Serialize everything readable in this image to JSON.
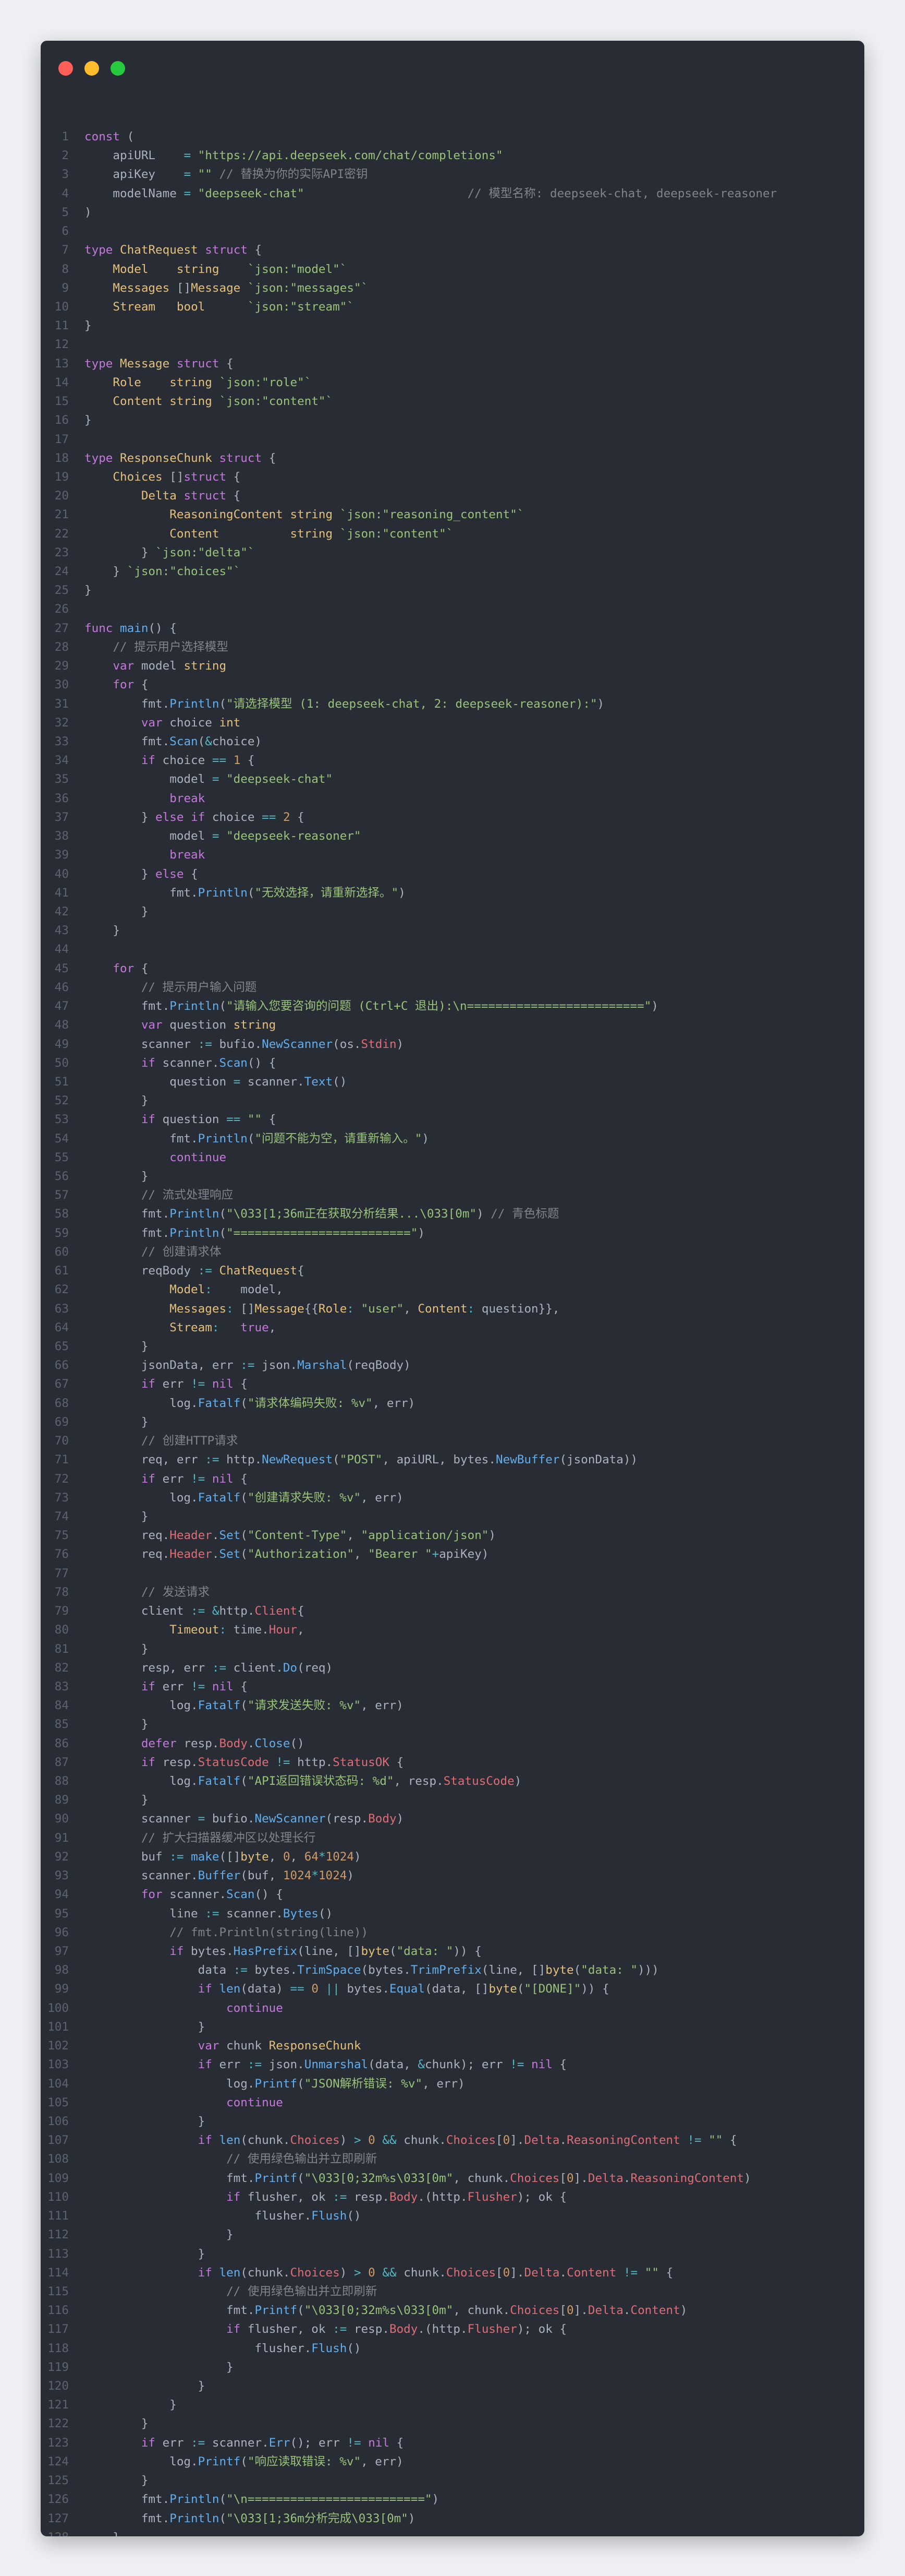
{
  "window": {
    "colors": {
      "background": "#282c34",
      "close": "#ff5f56",
      "minimize": "#ffbd2e",
      "maximize": "#27c93f"
    }
  },
  "code_lines": [
    "const (",
    "    apiURL    = \"https://api.deepseek.com/chat/completions\"",
    "    apiKey    = \"\" // 替换为你的实际API密钥",
    "    modelName = \"deepseek-chat\"                       // 模型名称: deepseek-chat, deepseek-reasoner",
    ")",
    "",
    "type ChatRequest struct {",
    "    Model    string    `json:\"model\"`",
    "    Messages []Message `json:\"messages\"`",
    "    Stream   bool      `json:\"stream\"`",
    "}",
    "",
    "type Message struct {",
    "    Role    string `json:\"role\"`",
    "    Content string `json:\"content\"`",
    "}",
    "",
    "type ResponseChunk struct {",
    "    Choices []struct {",
    "        Delta struct {",
    "            ReasoningContent string `json:\"reasoning_content\"`",
    "            Content          string `json:\"content\"`",
    "        } `json:\"delta\"`",
    "    } `json:\"choices\"`",
    "}",
    "",
    "func main() {",
    "    // 提示用户选择模型",
    "    var model string",
    "    for {",
    "        fmt.Println(\"请选择模型 (1: deepseek-chat, 2: deepseek-reasoner):\")",
    "        var choice int",
    "        fmt.Scan(&choice)",
    "        if choice == 1 {",
    "            model = \"deepseek-chat\"",
    "            break",
    "        } else if choice == 2 {",
    "            model = \"deepseek-reasoner\"",
    "            break",
    "        } else {",
    "            fmt.Println(\"无效选择，请重新选择。\")",
    "        }",
    "    }",
    "",
    "    for {",
    "        // 提示用户输入问题",
    "        fmt.Println(\"请输入您要咨询的问题 (Ctrl+C 退出):\\n=========================\")",
    "        var question string",
    "        scanner := bufio.NewScanner(os.Stdin)",
    "        if scanner.Scan() {",
    "            question = scanner.Text()",
    "        }",
    "        if question == \"\" {",
    "            fmt.Println(\"问题不能为空，请重新输入。\")",
    "            continue",
    "        }",
    "        // 流式处理响应",
    "        fmt.Println(\"\\033[1;36m正在获取分析结果...\\033[0m\") // 青色标题",
    "        fmt.Println(\"=========================\")",
    "        // 创建请求体",
    "        reqBody := ChatRequest{",
    "            Model:    model,",
    "            Messages: []Message{{Role: \"user\", Content: question}},",
    "            Stream:   true,",
    "        }",
    "        jsonData, err := json.Marshal(reqBody)",
    "        if err != nil {",
    "            log.Fatalf(\"请求体编码失败: %v\", err)",
    "        }",
    "        // 创建HTTP请求",
    "        req, err := http.NewRequest(\"POST\", apiURL, bytes.NewBuffer(jsonData))",
    "        if err != nil {",
    "            log.Fatalf(\"创建请求失败: %v\", err)",
    "        }",
    "        req.Header.Set(\"Content-Type\", \"application/json\")",
    "        req.Header.Set(\"Authorization\", \"Bearer \"+apiKey)",
    "",
    "        // 发送请求",
    "        client := &http.Client{",
    "            Timeout: time.Hour,",
    "        }",
    "        resp, err := client.Do(req)",
    "        if err != nil {",
    "            log.Fatalf(\"请求发送失败: %v\", err)",
    "        }",
    "        defer resp.Body.Close()",
    "        if resp.StatusCode != http.StatusOK {",
    "            log.Fatalf(\"API返回错误状态码: %d\", resp.StatusCode)",
    "        }",
    "        scanner = bufio.NewScanner(resp.Body)",
    "        // 扩大扫描器缓冲区以处理长行",
    "        buf := make([]byte, 0, 64*1024)",
    "        scanner.Buffer(buf, 1024*1024)",
    "        for scanner.Scan() {",
    "            line := scanner.Bytes()",
    "            // fmt.Println(string(line))",
    "            if bytes.HasPrefix(line, []byte(\"data: \")) {",
    "                data := bytes.TrimSpace(bytes.TrimPrefix(line, []byte(\"data: \")))",
    "                if len(data) == 0 || bytes.Equal(data, []byte(\"[DONE]\")) {",
    "                    continue",
    "                }",
    "                var chunk ResponseChunk",
    "                if err := json.Unmarshal(data, &chunk); err != nil {",
    "                    log.Printf(\"JSON解析错误: %v\", err)",
    "                    continue",
    "                }",
    "                if len(chunk.Choices) > 0 && chunk.Choices[0].Delta.ReasoningContent != \"\" {",
    "                    // 使用绿色输出并立即刷新",
    "                    fmt.Printf(\"\\033[0;32m%s\\033[0m\", chunk.Choices[0].Delta.ReasoningContent)",
    "                    if flusher, ok := resp.Body.(http.Flusher); ok {",
    "                        flusher.Flush()",
    "                    }",
    "                }",
    "                if len(chunk.Choices) > 0 && chunk.Choices[0].Delta.Content != \"\" {",
    "                    // 使用绿色输出并立即刷新",
    "                    fmt.Printf(\"\\033[0;32m%s\\033[0m\", chunk.Choices[0].Delta.Content)",
    "                    if flusher, ok := resp.Body.(http.Flusher); ok {",
    "                        flusher.Flush()",
    "                    }",
    "                }",
    "            }",
    "        }",
    "        if err := scanner.Err(); err != nil {",
    "            log.Printf(\"响应读取错误: %v\", err)",
    "        }",
    "        fmt.Println(\"\\n=========================\")",
    "        fmt.Println(\"\\033[1;36m分析完成\\033[0m\")",
    "    }",
    "}"
  ]
}
